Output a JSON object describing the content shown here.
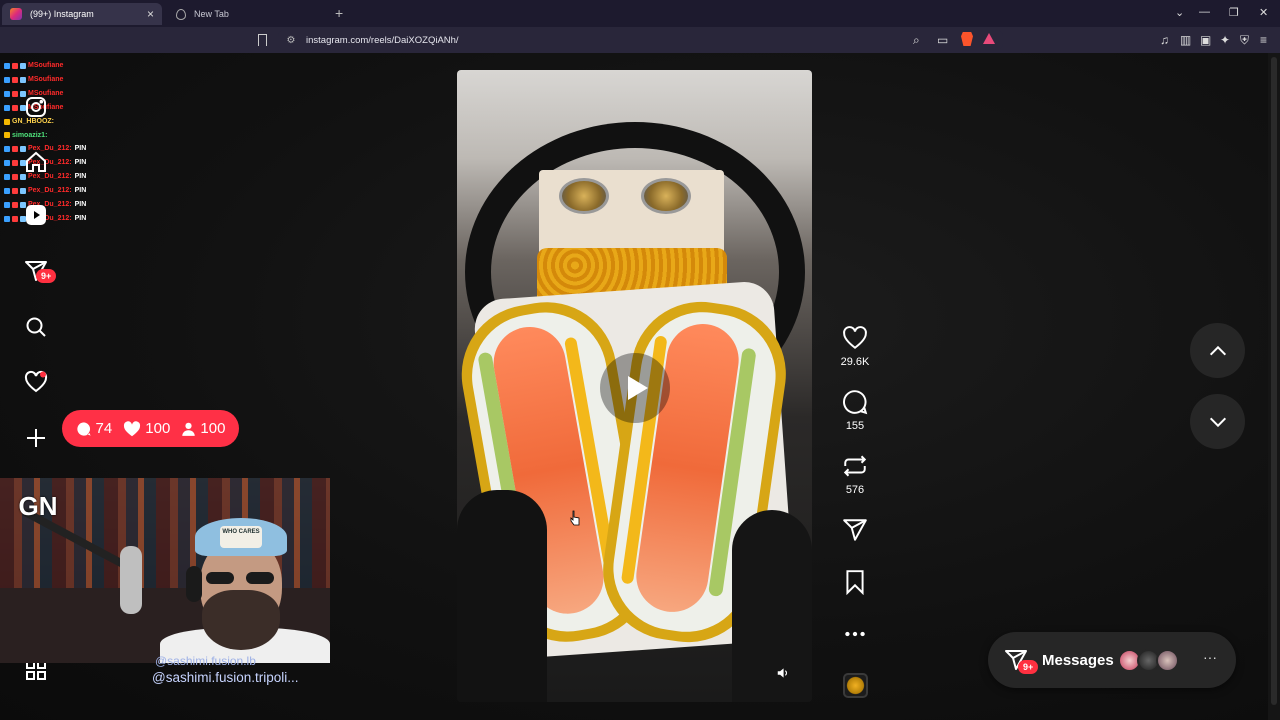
{
  "browser": {
    "tabs": [
      {
        "title": "(99+) Instagram",
        "active": true
      },
      {
        "title": "New Tab",
        "active": false
      }
    ],
    "url": "instagram.com/reels/DaiXOZQiANh/"
  },
  "chat": [
    {
      "user": "MSoufiane",
      "msg": "",
      "color": "red"
    },
    {
      "user": "MSoufiane",
      "msg": "",
      "color": "red"
    },
    {
      "user": "MSoufiane",
      "msg": "",
      "color": "red"
    },
    {
      "user": "MSoufiane",
      "msg": "",
      "color": "red"
    },
    {
      "user": "GN_HBOOZ:",
      "msg": "",
      "color": "yellow"
    },
    {
      "user": "simoaziz1:",
      "msg": "",
      "color": "green"
    },
    {
      "user": "Pex_Du_212:",
      "msg": "PIN",
      "color": "red"
    },
    {
      "user": "Pex_Du_212:",
      "msg": "PIN",
      "color": "red"
    },
    {
      "user": "Pex_Du_212:",
      "msg": "PIN",
      "color": "red"
    },
    {
      "user": "Pex_Du_212:",
      "msg": "PIN",
      "color": "red"
    },
    {
      "user": "Pex_Du_212:",
      "msg": "PIN",
      "color": "red"
    },
    {
      "user": "Pex_Du_212:",
      "msg": "PIN",
      "color": "red"
    }
  ],
  "sidebar": {
    "messages_badge": "9+"
  },
  "stream_stats": {
    "comments": "74",
    "likes": "100",
    "viewers": "100"
  },
  "webcam": {
    "logo_text": "GN",
    "cap_text": "WHO CARES"
  },
  "reel": {
    "caption_behind": "@sashimi.fusion.lb",
    "caption": "@sashimi.fusion.tripoli...",
    "likes": "29.6K",
    "comments": "155",
    "reposts": "576"
  },
  "messages_panel": {
    "label": "Messages",
    "badge": "9+"
  },
  "colors": {
    "accent_red": "#ff3040",
    "page_bg": "#111111",
    "chrome_bg": "#1d1a2e"
  }
}
